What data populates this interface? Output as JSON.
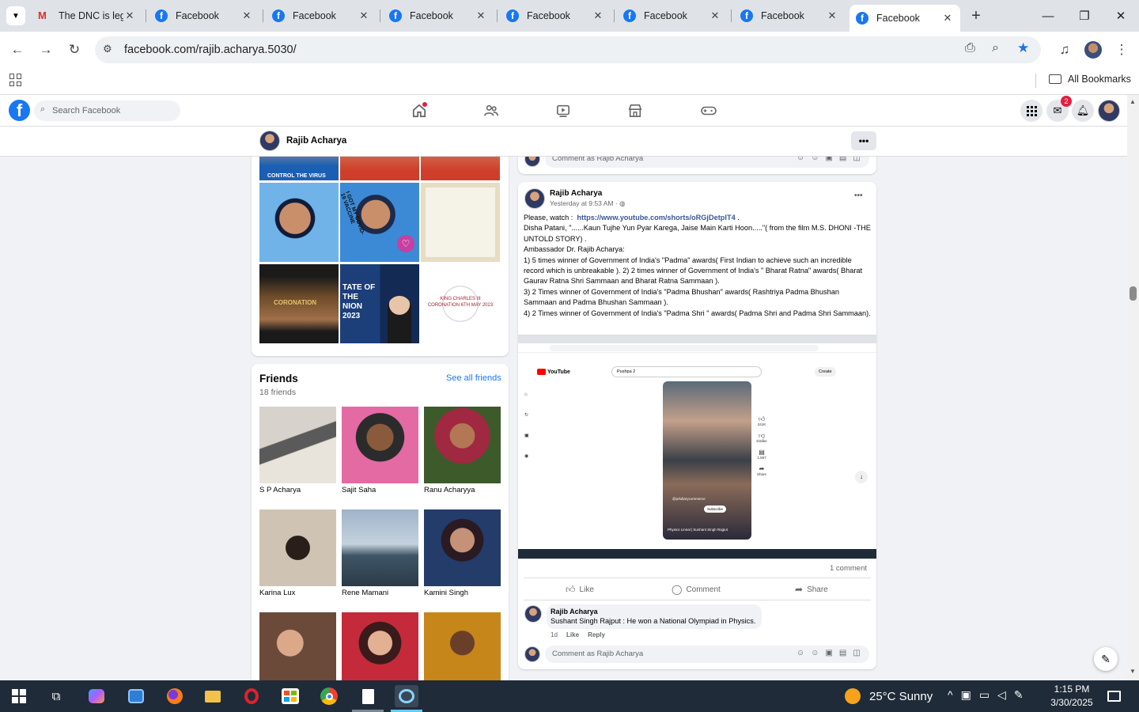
{
  "browser": {
    "tabs": [
      {
        "title": "The DNC is leg",
        "icon": "gmail-icon"
      },
      {
        "title": "Facebook",
        "icon": "facebook-icon"
      },
      {
        "title": "Facebook",
        "icon": "facebook-icon"
      },
      {
        "title": "Facebook",
        "icon": "facebook-icon"
      },
      {
        "title": "Facebook",
        "icon": "facebook-icon"
      },
      {
        "title": "Facebook",
        "icon": "facebook-icon"
      },
      {
        "title": "Facebook",
        "icon": "facebook-icon"
      },
      {
        "title": "Facebook",
        "icon": "facebook-icon",
        "active": true
      }
    ],
    "url": "facebook.com/rajib.acharya.5030/",
    "bookmarks_label": "All Bookmarks"
  },
  "facebook": {
    "search_placeholder": "Search Facebook",
    "messenger_badge": "2",
    "profile_name": "Rajib Acharya",
    "brand_color": "#1877f2"
  },
  "friends": {
    "title": "Friends",
    "count": "18 friends",
    "see_all": "See all friends",
    "list": [
      {
        "name": "S P Acharya"
      },
      {
        "name": "Sajit Saha"
      },
      {
        "name": "Ranu Acharyya"
      },
      {
        "name": "Karina Lux"
      },
      {
        "name": "Rene Mamani"
      },
      {
        "name": "Kamini Singh"
      }
    ]
  },
  "photos": {
    "photo_texts": [
      "CONTROL THE VIRUS",
      "I GOT MY COVID-19 VACCINE",
      "CORONATION",
      "TATE OF THE NION 2023",
      "KING CHARLES III CORONATION 6TH MAY 2023"
    ]
  },
  "top_comment_box": {
    "placeholder": "Comment as Rajib Acharya"
  },
  "post": {
    "author": "Rajib Acharya",
    "time": "Yesterday at 9:53 AM ·",
    "line1_prefix": "Please, watch :",
    "line1_link": "https://www.youtube.com/shorts/oRGjDetpIT4",
    "line1_suffix": ".",
    "line2": " Disha Patani, \"......Kaun Tujhe Yun Pyar Karega, Jaise Main Karti Hoon.....\"( from the film M.S. DHONI -THE UNTOLD STORY) .",
    "line3": "Ambassador Dr. Rajib Acharya:",
    "line4": "1) 5 times winner of Government of India's \"Padma\" awards( First Indian to achieve such an incredible record which is unbreakable ). 2) 2 times winner of Government of India's \" Bharat Ratna\" awards( Bharat Gaurav Ratna Shri Sammaan and Bharat Ratna Sammaan ).",
    "line5": "3) 2 Times winner of Government of India's \"Padma Bhushan\" awards( Rashtriya Padma Bhushan Sammaan and Padma Bhushan Sammaan ).",
    "line6": "4) 2 Times winner of Government of India's \"Padma Shri \" awards( Padma Shri and Padma Shri Sammaan).",
    "comment_count": "1 comment",
    "like_label": "Like",
    "comment_label": "Comment",
    "share_label": "Share",
    "screenshot": {
      "search_text": "Pushpa 2",
      "create_label": "Create",
      "likes": "241K",
      "dislike": "Dislike",
      "comments": "1,567",
      "share": "Share",
      "subscribe": "Subscribe",
      "channel": "@prkdiarycommerce",
      "caption": "Physics Lineal | Sushant Singh Rajput",
      "youtube": "YouTube"
    },
    "comment": {
      "author": "Rajib Acharya",
      "text": "Sushant Singh Rajput : He won a National Olympiad in Physics.",
      "age": "1d",
      "like": "Like",
      "reply": "Reply"
    },
    "comment_placeholder": "Comment as Rajib Acharya"
  },
  "taskbar": {
    "weather": "25°C  Sunny",
    "time": "1:15 PM",
    "date": "3/30/2025"
  }
}
